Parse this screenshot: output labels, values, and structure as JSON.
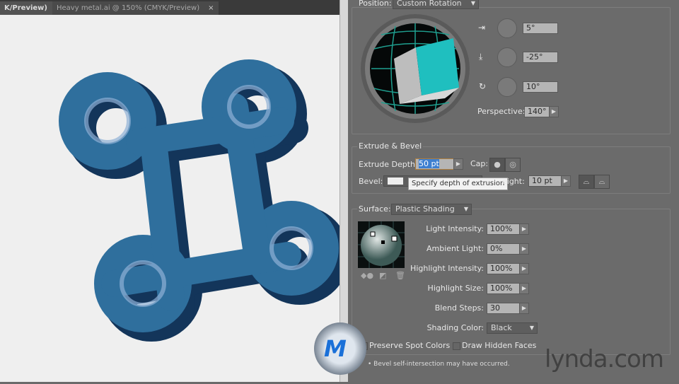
{
  "tabs": [
    {
      "label": "K/Preview)",
      "active": true
    },
    {
      "label": "Heavy metal.ai @ 150% (CMYK/Preview)",
      "active": false
    }
  ],
  "tab_close": "×",
  "rotation": {
    "position_label": "Position:",
    "position_value": "Custom Rotation",
    "x_angle": "5°",
    "y_angle": "-25°",
    "z_angle": "10°",
    "perspective_label": "Perspective:",
    "perspective_value": "140°"
  },
  "extrude": {
    "title": "Extrude & Bevel",
    "depth_label": "Extrude Depth:",
    "depth_value": "50 pt",
    "cap_label": "Cap:",
    "bevel_label": "Bevel:",
    "height_label": "eight:",
    "height_value": "10 pt",
    "tooltip": "Specify depth of extrusion"
  },
  "surface": {
    "label": "Surface:",
    "value": "Plastic Shading",
    "fields": [
      {
        "label": "Light Intensity:",
        "value": "100%"
      },
      {
        "label": "Ambient Light:",
        "value": "0%"
      },
      {
        "label": "Highlight Intensity:",
        "value": "100%"
      },
      {
        "label": "Highlight Size:",
        "value": "100%"
      },
      {
        "label": "Blend Steps:",
        "value": "30"
      }
    ],
    "shading_label": "Shading Color:",
    "shading_value": "Black"
  },
  "options": {
    "preserve_spot": "Preserve Spot Colors",
    "draw_hidden": "Draw Hidden Faces",
    "preserve_checked": false,
    "draw_hidden_checked": false
  },
  "warning": "• Bevel self-intersection may have occurred.",
  "watermark": "lynda.com",
  "colors": {
    "object": "#2f6f9d",
    "cube": "#1fbfbf",
    "panel": "#6b6b6b"
  }
}
